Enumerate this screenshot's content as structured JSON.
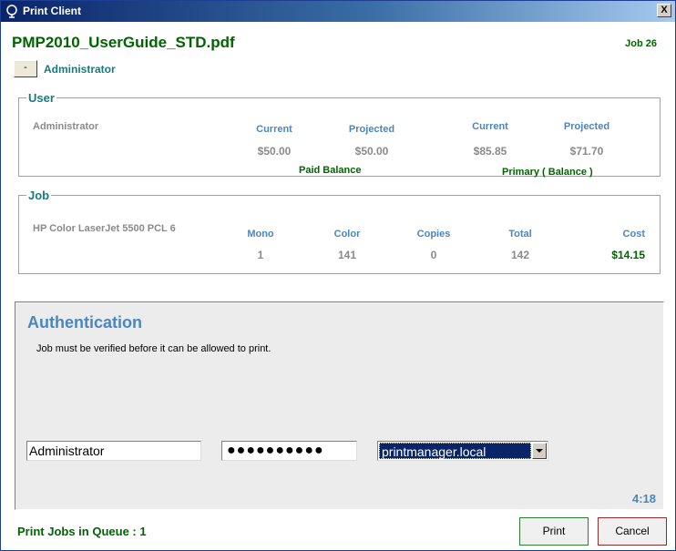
{
  "window": {
    "title": "Print Client",
    "close_label": "X"
  },
  "header": {
    "document_name": "PMP2010_UserGuide_STD.pdf",
    "job_id": "Job 26",
    "collapse_label": "-",
    "user_display": "Administrator"
  },
  "user_group": {
    "legend": "User",
    "name": "Administrator",
    "paid": {
      "current_label": "Current",
      "projected_label": "Projected",
      "current_value": "$50.00",
      "projected_value": "$50.00",
      "caption": "Paid Balance"
    },
    "primary": {
      "current_label": "Current",
      "projected_label": "Projected",
      "current_value": "$85.85",
      "projected_value": "$71.70",
      "caption": "Primary ( Balance )"
    }
  },
  "job_group": {
    "legend": "Job",
    "printer": "HP Color LaserJet 5500 PCL 6",
    "headers": {
      "mono": "Mono",
      "color": "Color",
      "copies": "Copies",
      "total": "Total",
      "cost": "Cost"
    },
    "values": {
      "mono": "1",
      "color": "141",
      "copies": "0",
      "total": "142",
      "cost": "$14.15"
    }
  },
  "auth": {
    "title": "Authentication",
    "message": "Job must be verified before it can be allowed to print.",
    "username": "Administrator",
    "password_mask": "●●●●●●●●●●",
    "domain": "printmanager.local",
    "countdown": "4:18"
  },
  "footer": {
    "queue_text": "Print Jobs in Queue : 1",
    "print_label": "Print",
    "cancel_label": "Cancel"
  },
  "colors": {
    "title_green": "#006400",
    "accent_teal": "#1a7a7a",
    "label_blue": "#4a86c0",
    "titlebar_blue": "#0a246a"
  },
  "icons": {
    "app": "printer-app-icon",
    "close": "close-icon",
    "dropdown": "chevron-down-icon"
  }
}
